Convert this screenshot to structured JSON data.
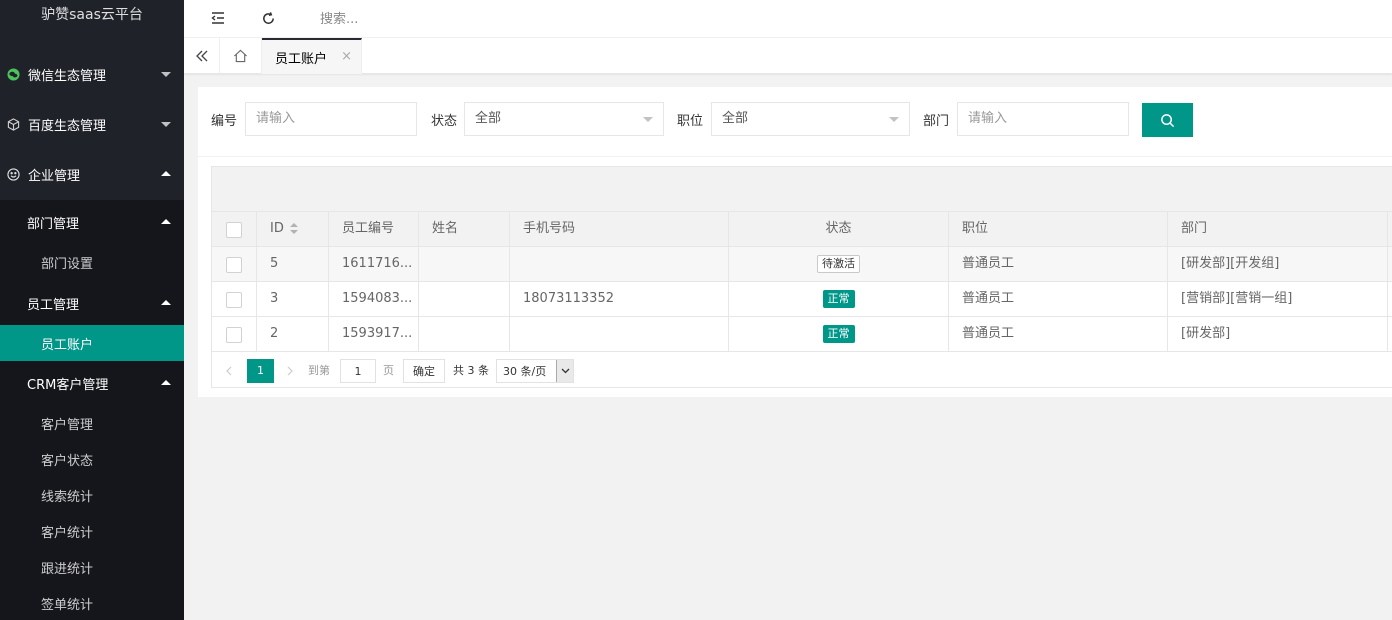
{
  "app": {
    "title": "驴赞saas云平台"
  },
  "sidebar": {
    "groups": [
      {
        "label": "微信生态管理",
        "icon": "wechat-icon"
      },
      {
        "label": "百度生态管理",
        "icon": "cube-icon"
      },
      {
        "label": "企业管理",
        "icon": "smile-icon"
      }
    ],
    "sub": {
      "dept": {
        "label": "部门管理",
        "items": [
          "部门设置"
        ]
      },
      "staff": {
        "label": "员工管理",
        "items": [
          "员工账户"
        ]
      },
      "crm": {
        "label": "CRM客户管理",
        "items": [
          "客户管理",
          "客户状态",
          "线索统计",
          "客户统计",
          "跟进统计",
          "签单统计"
        ]
      }
    }
  },
  "header": {
    "search_placeholder": "搜索..."
  },
  "tabs": {
    "active": "员工账户",
    "close": "×"
  },
  "filters": {
    "code_label": "编号",
    "code_placeholder": "请输入",
    "status_label": "状态",
    "status_value": "全部",
    "position_label": "职位",
    "position_value": "全部",
    "dept_label": "部门",
    "dept_placeholder": "请输入"
  },
  "table": {
    "columns": [
      "ID",
      "员工编号",
      "姓名",
      "手机号码",
      "状态",
      "职位",
      "部门"
    ],
    "rows": [
      {
        "id": "5",
        "code": "1611716...",
        "name": "",
        "phone": "",
        "status": "待激活",
        "status_type": "outline",
        "position": "普通员工",
        "dept": "[研发部][开发组]"
      },
      {
        "id": "3",
        "code": "1594083...",
        "name": "",
        "phone": "18073113352",
        "status": "正常",
        "status_type": "green",
        "position": "普通员工",
        "dept": "[营销部][营销一组]"
      },
      {
        "id": "2",
        "code": "1593917...",
        "name": "",
        "phone": "",
        "status": "正常",
        "status_type": "green",
        "position": "普通员工",
        "dept": "[研发部]"
      }
    ]
  },
  "pagination": {
    "current": "1",
    "goto_label": "到第",
    "goto_value": "1",
    "page_unit": "页",
    "confirm": "确定",
    "total": "共 3 条",
    "page_size": "30 条/页"
  },
  "colors": {
    "accent": "#009688",
    "sidebar_bg": "#20222a",
    "sidebar_sub_bg": "#15161b"
  }
}
